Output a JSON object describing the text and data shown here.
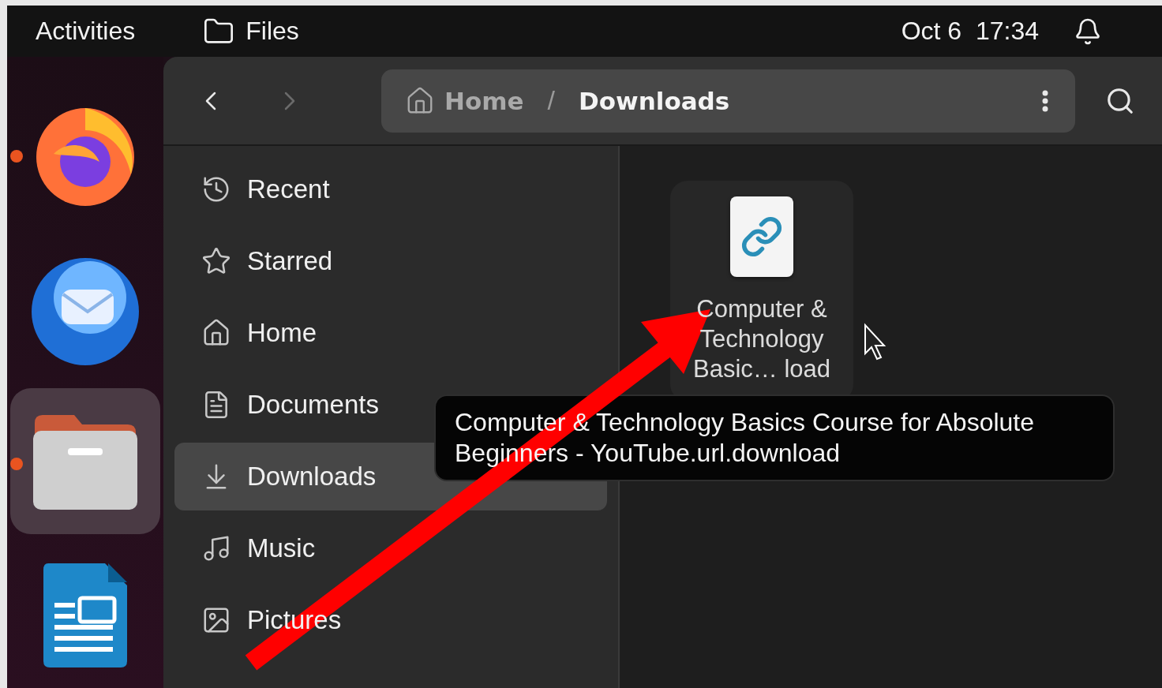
{
  "top_bar": {
    "activities": "Activities",
    "app_name": "Files",
    "clock": "Oct 6  17:34"
  },
  "dock": [
    {
      "kind": "browser",
      "running": true,
      "selected": false
    },
    {
      "kind": "mail",
      "running": false,
      "selected": false
    },
    {
      "kind": "files",
      "running": true,
      "selected": true
    },
    {
      "kind": "writer",
      "running": false,
      "selected": false
    }
  ],
  "header": {
    "path": [
      {
        "label": "Home",
        "kind": "home",
        "current": false
      },
      {
        "label": "Downloads",
        "kind": "folder",
        "current": true
      }
    ],
    "separator": "/"
  },
  "sidebar": {
    "items": [
      {
        "label": "Recent",
        "kind": "recent",
        "selected": false
      },
      {
        "label": "Starred",
        "kind": "starred",
        "selected": false
      },
      {
        "label": "Home",
        "kind": "home",
        "selected": false
      },
      {
        "label": "Documents",
        "kind": "documents",
        "selected": false
      },
      {
        "label": "Downloads",
        "kind": "downloads",
        "selected": true
      },
      {
        "label": "Music",
        "kind": "music",
        "selected": false
      },
      {
        "label": "Pictures",
        "kind": "pictures",
        "selected": false
      }
    ]
  },
  "files": [
    {
      "name": "Computer & Technology Basic… load",
      "kind": "link"
    }
  ],
  "tooltip": "Computer & Technology Basics Course for Absolute Beginners - YouTube.url.download"
}
